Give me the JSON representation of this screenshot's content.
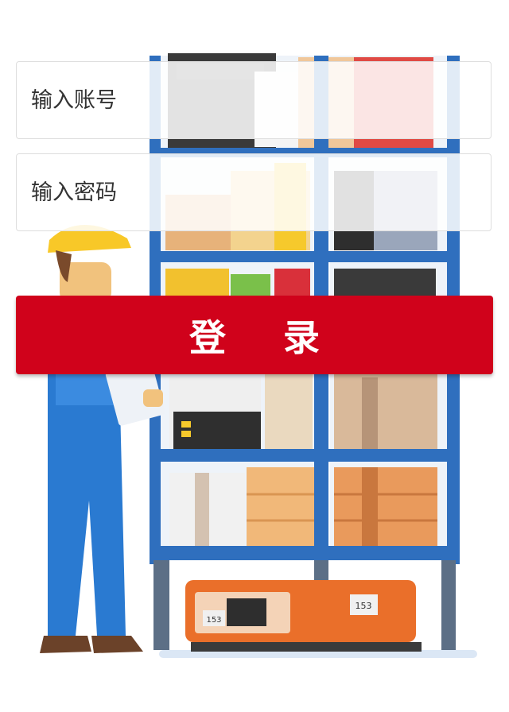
{
  "login": {
    "account_placeholder": "输入账号",
    "password_placeholder": "输入密码",
    "submit_label": "登 录"
  },
  "colors": {
    "primary": "#d0021b",
    "shelf_frame": "#2f6fbe",
    "worker_overalls": "#2a7ad1",
    "helmet": "#f8c828",
    "robot": "#ea6f2a"
  },
  "icons": {
    "hero": "warehouse-worker-illustration"
  },
  "illustration": {
    "robot_tag_front": "153",
    "robot_tag_back": "153"
  }
}
